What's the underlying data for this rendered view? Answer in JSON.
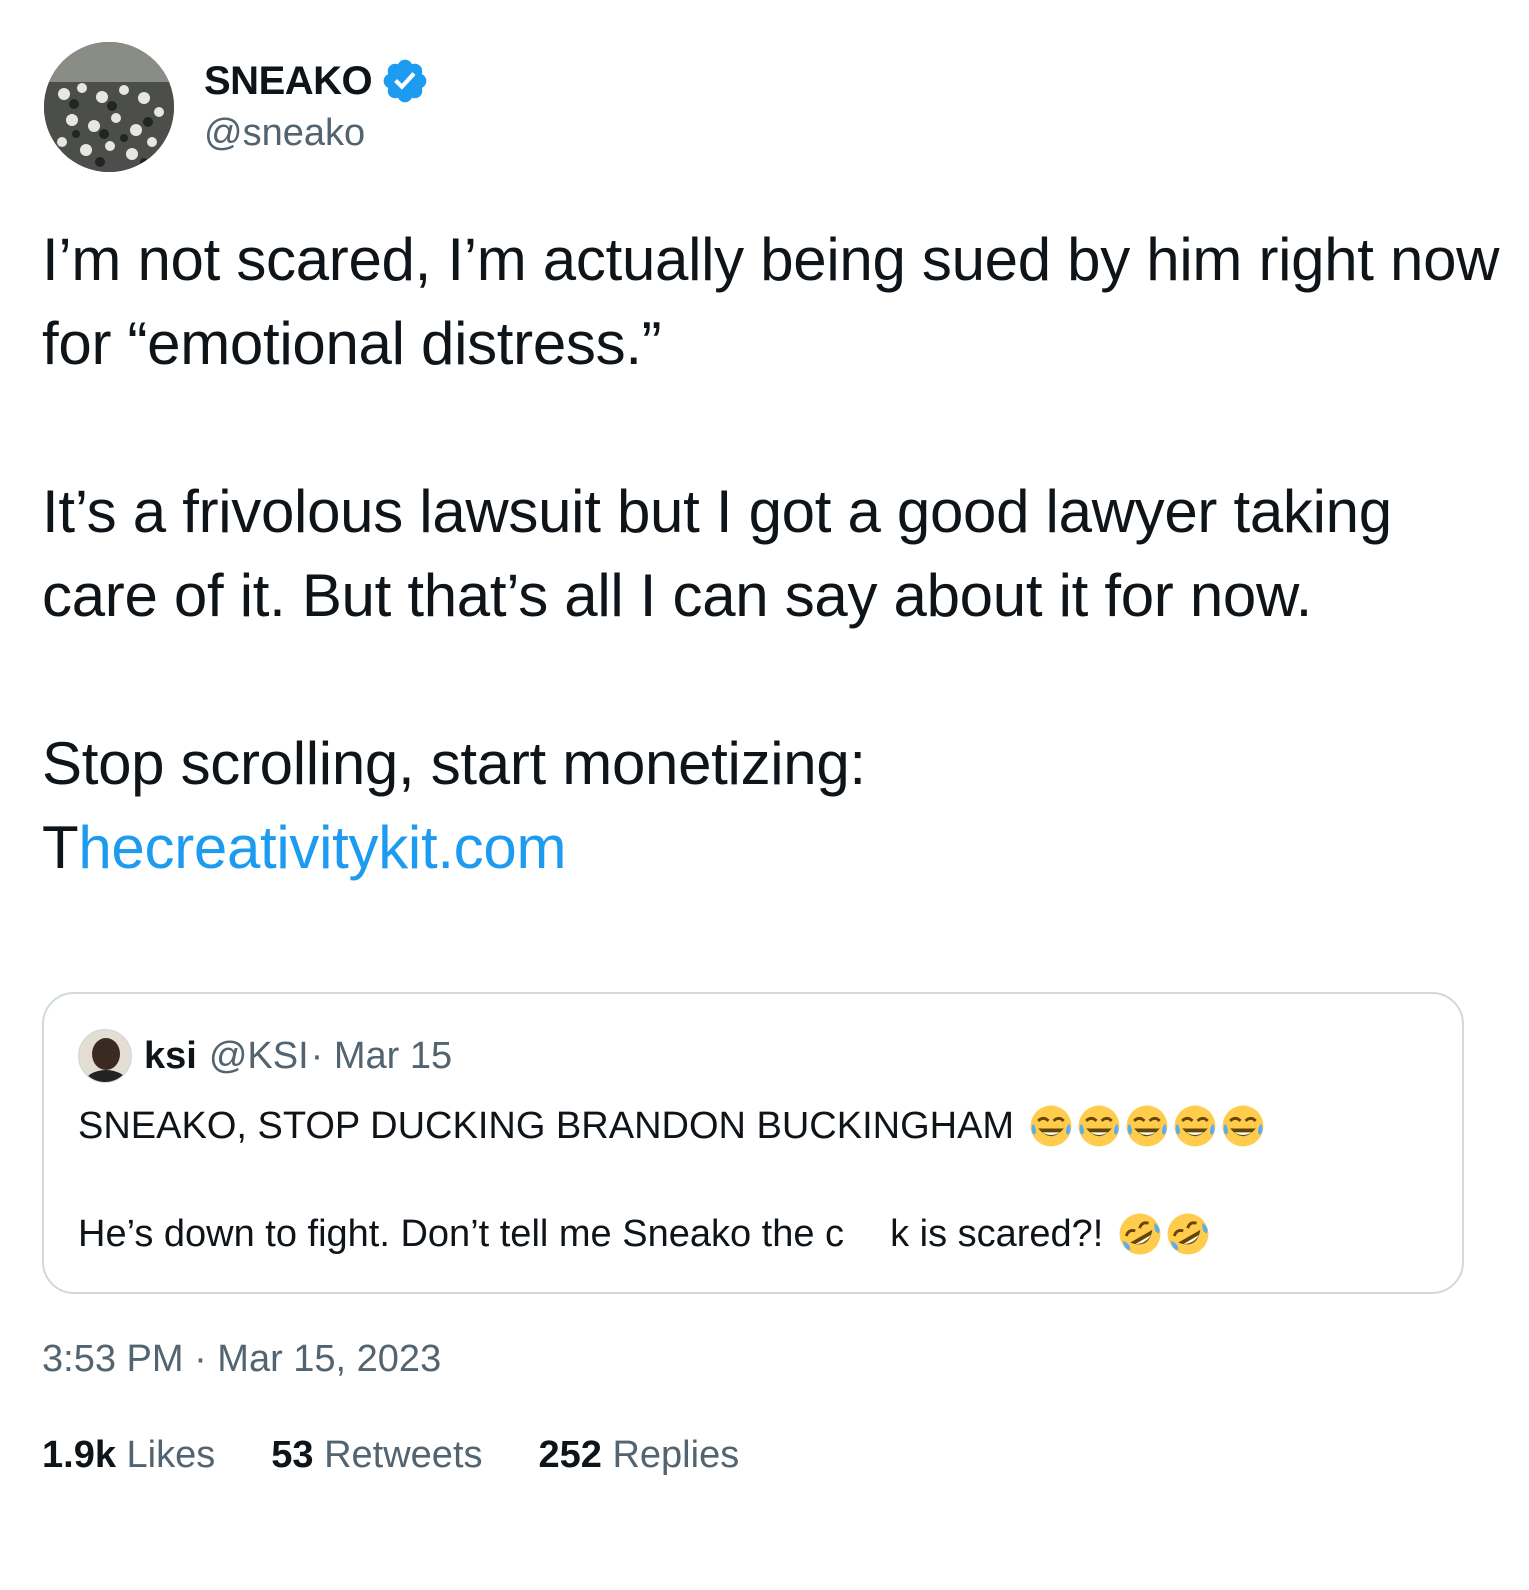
{
  "author": {
    "display_name": "SNEAKO",
    "handle": "@sneako",
    "verified": true,
    "avatar_icon": "crowd-photo-avatar",
    "verified_color": "#1d9bf0"
  },
  "body": {
    "para1": "I’m not scared, I’m actually being sued by him right now for “emotional distress.”",
    "para2": "It’s a frivolous lawsuit but I got a good lawyer taking care of it. But that’s all I can say about it for now.",
    "para3": "Stop scrolling, start monetizing:",
    "link_prefix": "T",
    "link_text": "hecreativitykit.com",
    "link_color": "#1d9bf0"
  },
  "quoted": {
    "name": "ksi",
    "handle": "@KSI",
    "date": "· Mar 15",
    "line1": "SNEAKO, STOP DUCKING BRANDON BUCKINGHAM",
    "line1_emoji": "face-with-tears-of-joy-icon",
    "line1_emoji_count": 5,
    "line2_start": "He’s down to fight. Don’t tell me Sneako the c",
    "line2_end": "k is scared?!",
    "line2_emoji": "rolling-on-floor-laughing-icon",
    "line2_emoji_count": 2
  },
  "timestamp": "3:53 PM · Mar 15, 2023",
  "stats": {
    "likes_count": "1.9k",
    "likes_label": "Likes",
    "retweets_count": "53",
    "retweets_label": "Retweets",
    "replies_count": "252",
    "replies_label": "Replies"
  },
  "colors": {
    "text": "#0f1419",
    "secondary": "#536471",
    "border": "#cfd9de"
  }
}
